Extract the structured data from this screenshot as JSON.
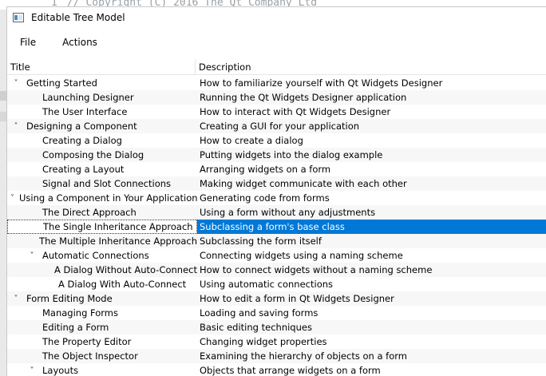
{
  "background": {
    "line_number": "1",
    "code_line": "// Copyright (C) 2016 The Qt Company Ltd"
  },
  "window": {
    "title": "Editable Tree Model"
  },
  "menu": [
    "File",
    "Actions"
  ],
  "columns": {
    "title": "Title",
    "description": "Description"
  },
  "colors": {
    "selection": "#0078d7",
    "alt_row": "#f7f7f7"
  },
  "rows": [
    {
      "title": "Getting Started",
      "description": "How to familiarize yourself with Qt Widgets Designer",
      "depth": 0,
      "expanded": true
    },
    {
      "title": "Launching Designer",
      "description": "Running the Qt Widgets Designer application",
      "depth": 1
    },
    {
      "title": "The User Interface",
      "description": "How to interact with Qt Widgets Designer",
      "depth": 1
    },
    {
      "title": "Designing a Component",
      "description": "Creating a GUI for your application",
      "depth": 0,
      "expanded": true
    },
    {
      "title": "Creating a Dialog",
      "description": "How to create a dialog",
      "depth": 1
    },
    {
      "title": "Composing the Dialog",
      "description": "Putting widgets into the dialog example",
      "depth": 1
    },
    {
      "title": "Creating a Layout",
      "description": "Arranging widgets on a form",
      "depth": 1
    },
    {
      "title": "Signal and Slot Connections",
      "description": "Making widget communicate with each other",
      "depth": 1
    },
    {
      "title": "Using a Component in Your Application",
      "description": "Generating code from forms",
      "depth": 0,
      "expanded": true
    },
    {
      "title": "The Direct Approach",
      "description": "Using a form without any adjustments",
      "depth": 1
    },
    {
      "title": "The Single Inheritance Approach",
      "description": "Subclassing a form's base class",
      "depth": 1,
      "selected": true
    },
    {
      "title": "The Multiple Inheritance Approach",
      "description": "Subclassing the form itself",
      "depth": 1
    },
    {
      "title": "Automatic Connections",
      "description": "Connecting widgets using a naming scheme",
      "depth": 1,
      "expanded": true
    },
    {
      "title": "A Dialog Without Auto-Connect",
      "description": "How to connect widgets without a naming scheme",
      "depth": 2
    },
    {
      "title": "A Dialog With Auto-Connect",
      "description": "Using automatic connections",
      "depth": 2
    },
    {
      "title": "Form Editing Mode",
      "description": "How to edit a form in Qt Widgets Designer",
      "depth": 0,
      "expanded": true
    },
    {
      "title": "Managing Forms",
      "description": "Loading and saving forms",
      "depth": 1
    },
    {
      "title": "Editing a Form",
      "description": "Basic editing techniques",
      "depth": 1
    },
    {
      "title": "The Property Editor",
      "description": "Changing widget properties",
      "depth": 1
    },
    {
      "title": "The Object Inspector",
      "description": "Examining the hierarchy of objects on a form",
      "depth": 1
    },
    {
      "title": "Layouts",
      "description": "Objects that arrange widgets on a form",
      "depth": 1,
      "expanded": true
    }
  ]
}
